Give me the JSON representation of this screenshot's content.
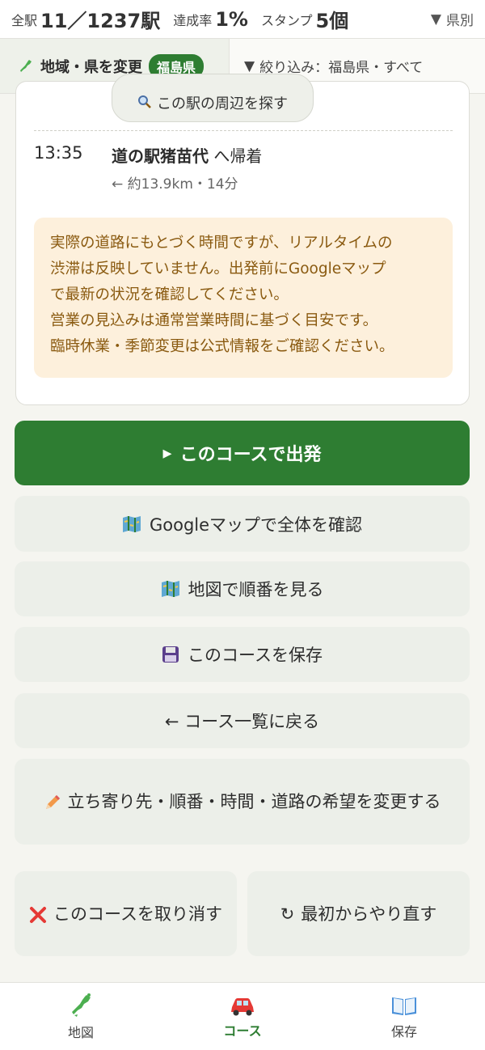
{
  "stats": {
    "total_label": "全駅",
    "total_value": "11／1237駅",
    "rate_label": "達成率",
    "rate_value": "1%",
    "stamp_label": "スタンプ",
    "stamp_value": "5個",
    "pref_toggle": "県別"
  },
  "filters": {
    "region_button": "地域・県を変更",
    "region_badge": "福島県",
    "filter_label": "絞り込み：福島県・すべて"
  },
  "route": {
    "nearby_button": "この駅の周辺を探す",
    "arrival_time": "13:35",
    "arrival_place": "道の駅猪苗代",
    "arrival_suffix": " へ帰着",
    "arrival_distance": "← 約13.9km・14分",
    "notice_lines": [
      "実際の道路にもとづく時間ですが、リアルタイムの",
      "渋滞は反映していません。出発前にGoogleマップ",
      "で最新の状況を確認してください。",
      "営業の見込みは通常営業時間に基づく目安です。",
      "臨時休業・季節変更は公式情報をご確認ください。"
    ]
  },
  "actions": {
    "start": "このコースで出発",
    "google_maps": "Googleマップで全体を確認",
    "map_order": "地図で順番を見る",
    "save": "このコースを保存",
    "back_to_list": "← コース一覧に戻る",
    "change_prefs": "立ち寄り先・順番・時間・道路の希望を変更する",
    "cancel": "このコースを取り消す",
    "restart": "最初からやり直す"
  },
  "nav": {
    "map": "地図",
    "course": "コース",
    "saved": "保存"
  },
  "colors": {
    "primary": "#2e7d32",
    "notice_bg": "#fdf0dc",
    "notice_text": "#8a5a10"
  },
  "icons": {
    "region": "japan-map-icon",
    "nearby": "magnifier-icon",
    "start": "play-triangle-icon",
    "google_maps": "map-icon",
    "map_order": "map-icon",
    "save": "floppy-disk-icon",
    "change": "pencil-icon",
    "cancel": "cross-mark-icon",
    "restart": "reload-icon",
    "nav_map": "japan-map-icon",
    "nav_course": "car-icon",
    "nav_saved": "book-icon"
  }
}
